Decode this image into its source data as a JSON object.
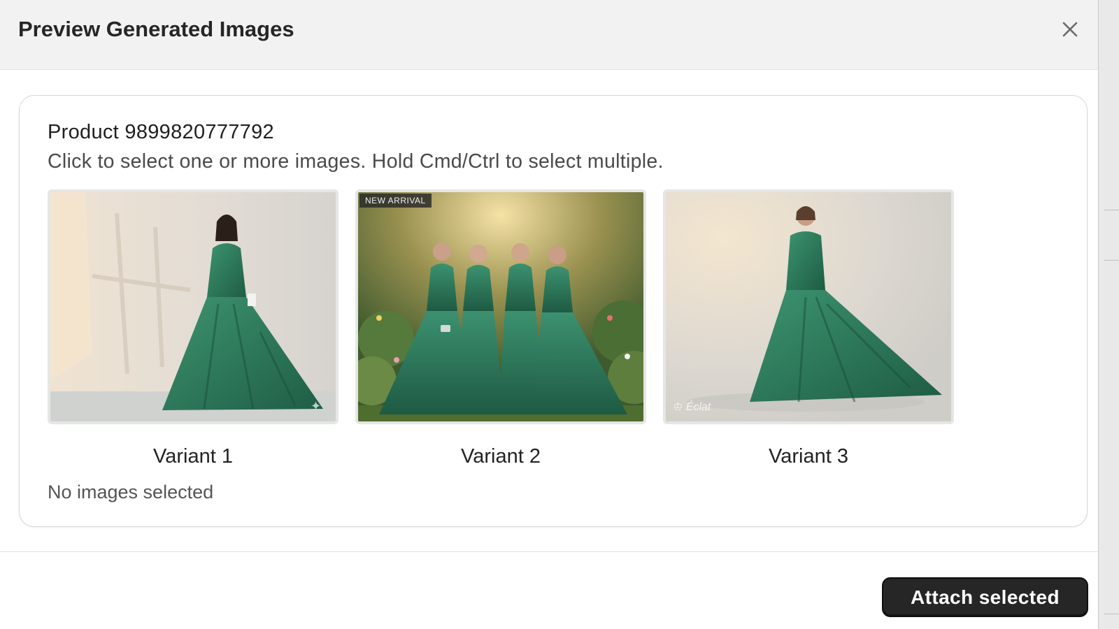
{
  "modal": {
    "title": "Preview Generated Images",
    "close_icon": "close-icon"
  },
  "panel": {
    "product_title": "Product 9899820777792",
    "instructions": "Click to select one or more images. Hold Cmd/Ctrl to select multiple.",
    "variants": [
      {
        "label": "Variant 1",
        "description": "model in emerald green satin gown, studio backdrop"
      },
      {
        "label": "Variant 2",
        "description": "four bridesmaids in emerald green gowns in garden",
        "badge": "NEW ARRIVAL"
      },
      {
        "label": "Variant 3",
        "description": "model twirling emerald green satin gown, studio backdrop"
      }
    ],
    "selection_status": "No images selected"
  },
  "footer": {
    "attach_label": "Attach selected"
  },
  "colors": {
    "header_bg": "#f2f2f2",
    "button_bg": "#262626",
    "gown_green": "#2f7d60"
  }
}
